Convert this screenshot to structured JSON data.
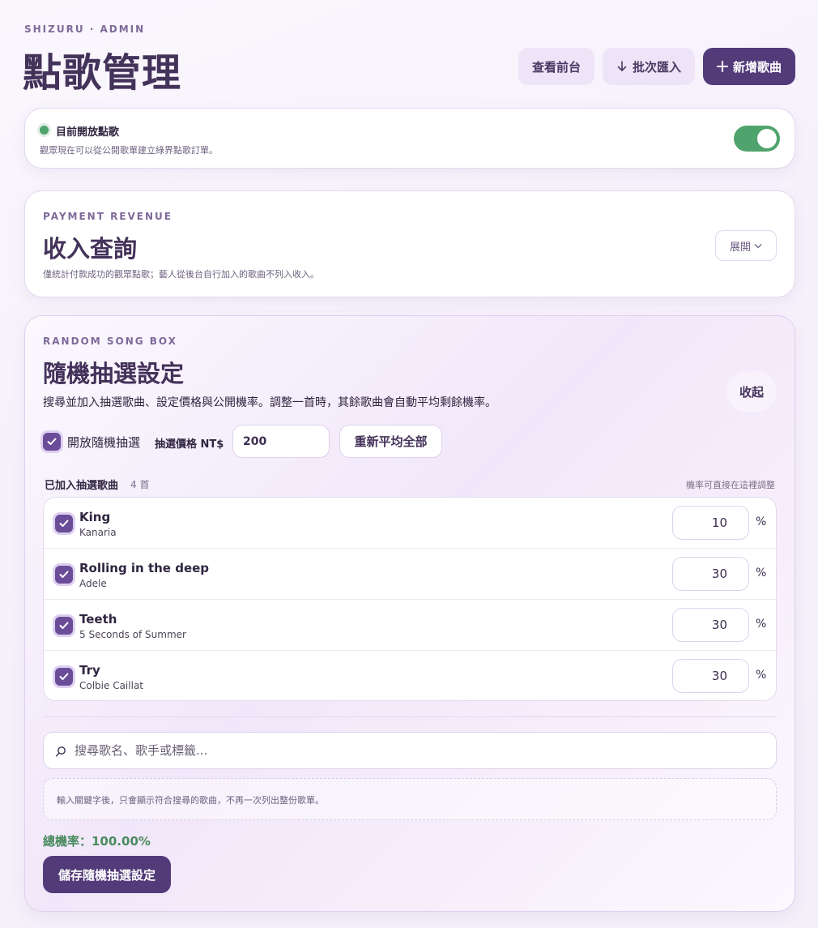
{
  "header": {
    "eyebrow": "SHIZURU · ADMIN",
    "title": "點歌管理",
    "view_frontend_label": "查看前台",
    "batch_import_label": "批次匯入",
    "add_song_label": "新增歌曲"
  },
  "status": {
    "title": "目前開放點歌",
    "description": "觀眾現在可以從公開歌單建立綠界點歌訂單。",
    "enabled": true,
    "status_color": "#4fa36c"
  },
  "revenue": {
    "eyebrow": "PAYMENT REVENUE",
    "title": "收入查詢",
    "note": "僅統計付款成功的觀眾點歌；藝人從後台自行加入的歌曲不列入收入。",
    "expand_label": "展開"
  },
  "random_box": {
    "eyebrow": "RANDOM SONG BOX",
    "title": "隨機抽選設定",
    "description": "搜尋並加入抽選歌曲、設定價格與公開機率。調整一首時，其餘歌曲會自動平均剩餘機率。",
    "collapse_label": "收起",
    "enable_label": "開放隨機抽選",
    "enabled": true,
    "price_label": "抽選價格 NT$",
    "price_value": "200",
    "reaverage_label": "重新平均全部",
    "songs_label": "已加入抽選歌曲",
    "songs_count": "4 首",
    "adjust_hint": "機率可直接在這裡調整",
    "songs": [
      {
        "title": "King",
        "artist": "Kanaria",
        "probability": "10",
        "unit": "%",
        "checked": true
      },
      {
        "title": "Rolling in the deep",
        "artist": "Adele",
        "probability": "30",
        "unit": "%",
        "checked": true
      },
      {
        "title": "Teeth",
        "artist": "5 Seconds of Summer",
        "probability": "30",
        "unit": "%",
        "checked": true
      },
      {
        "title": "Try",
        "artist": "Colbie Caillat",
        "probability": "30",
        "unit": "%",
        "checked": true
      }
    ],
    "search_placeholder": "搜尋歌名、歌手或標籤...",
    "search_hint": "輸入關鍵字後，只會顯示符合搜尋的歌曲，不再一次列出整份歌單。",
    "total_label": "總機率：100.00%",
    "save_label": "儲存隨機抽選設定"
  },
  "colors": {
    "accent": "#533b7a",
    "success": "#4fa36c",
    "total_text": "#4a8a5e"
  }
}
